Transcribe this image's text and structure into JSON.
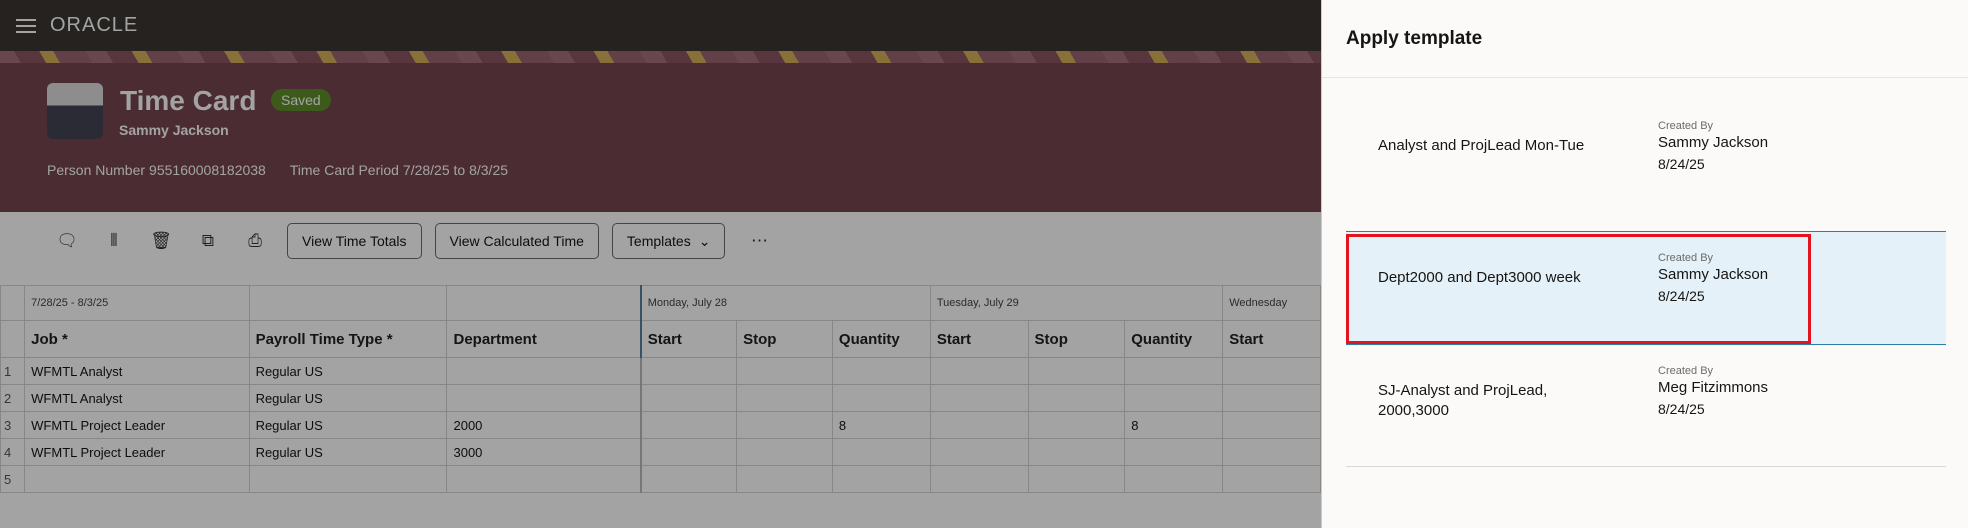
{
  "nav": {
    "logo": "ORACLE"
  },
  "header": {
    "title": "Time Card",
    "status": "Saved",
    "person_name": "Sammy Jackson",
    "person_number_label": "Person Number",
    "person_number": "955160008182038",
    "period_label": "Time Card Period",
    "period": "7/28/25 to 8/3/25"
  },
  "toolbar": {
    "view_time_totals": "View Time Totals",
    "view_calculated_time": "View Calculated Time",
    "templates": "Templates",
    "more": "⋯"
  },
  "grid": {
    "period": "7/28/25 - 8/3/25",
    "days": [
      "Monday, July 28",
      "Tuesday, July 29",
      "Wednesday"
    ],
    "columns": [
      "Job *",
      "Payroll Time Type *",
      "Department",
      "Start",
      "Stop",
      "Quantity",
      "Start",
      "Stop",
      "Quantity",
      "Start"
    ],
    "rows": [
      {
        "n": "1",
        "job": "WFMTL Analyst",
        "type": "Regular US",
        "dept": "",
        "q1": "",
        "q2": ""
      },
      {
        "n": "2",
        "job": "WFMTL Analyst",
        "type": "Regular US",
        "dept": "",
        "q1": "",
        "q2": ""
      },
      {
        "n": "3",
        "job": "WFMTL Project Leader",
        "type": "Regular US",
        "dept": "2000",
        "q1": "8",
        "q2": "8"
      },
      {
        "n": "4",
        "job": "WFMTL Project Leader",
        "type": "Regular US",
        "dept": "3000",
        "q1": "",
        "q2": ""
      },
      {
        "n": "5",
        "job": "",
        "type": "",
        "dept": "",
        "q1": "",
        "q2": ""
      }
    ]
  },
  "panel": {
    "title": "Apply template",
    "created_by_label": "Created By",
    "templates": [
      {
        "name": "Analyst and ProjLead Mon-Tue",
        "created_by": "Sammy Jackson",
        "date": "8/24/25"
      },
      {
        "name": "Dept2000 and Dept3000 week",
        "created_by": "Sammy Jackson",
        "date": "8/24/25"
      },
      {
        "name": "SJ-Analyst and ProjLead, 2000,3000",
        "created_by": "Meg Fitzimmons",
        "date": "8/24/25"
      }
    ]
  }
}
